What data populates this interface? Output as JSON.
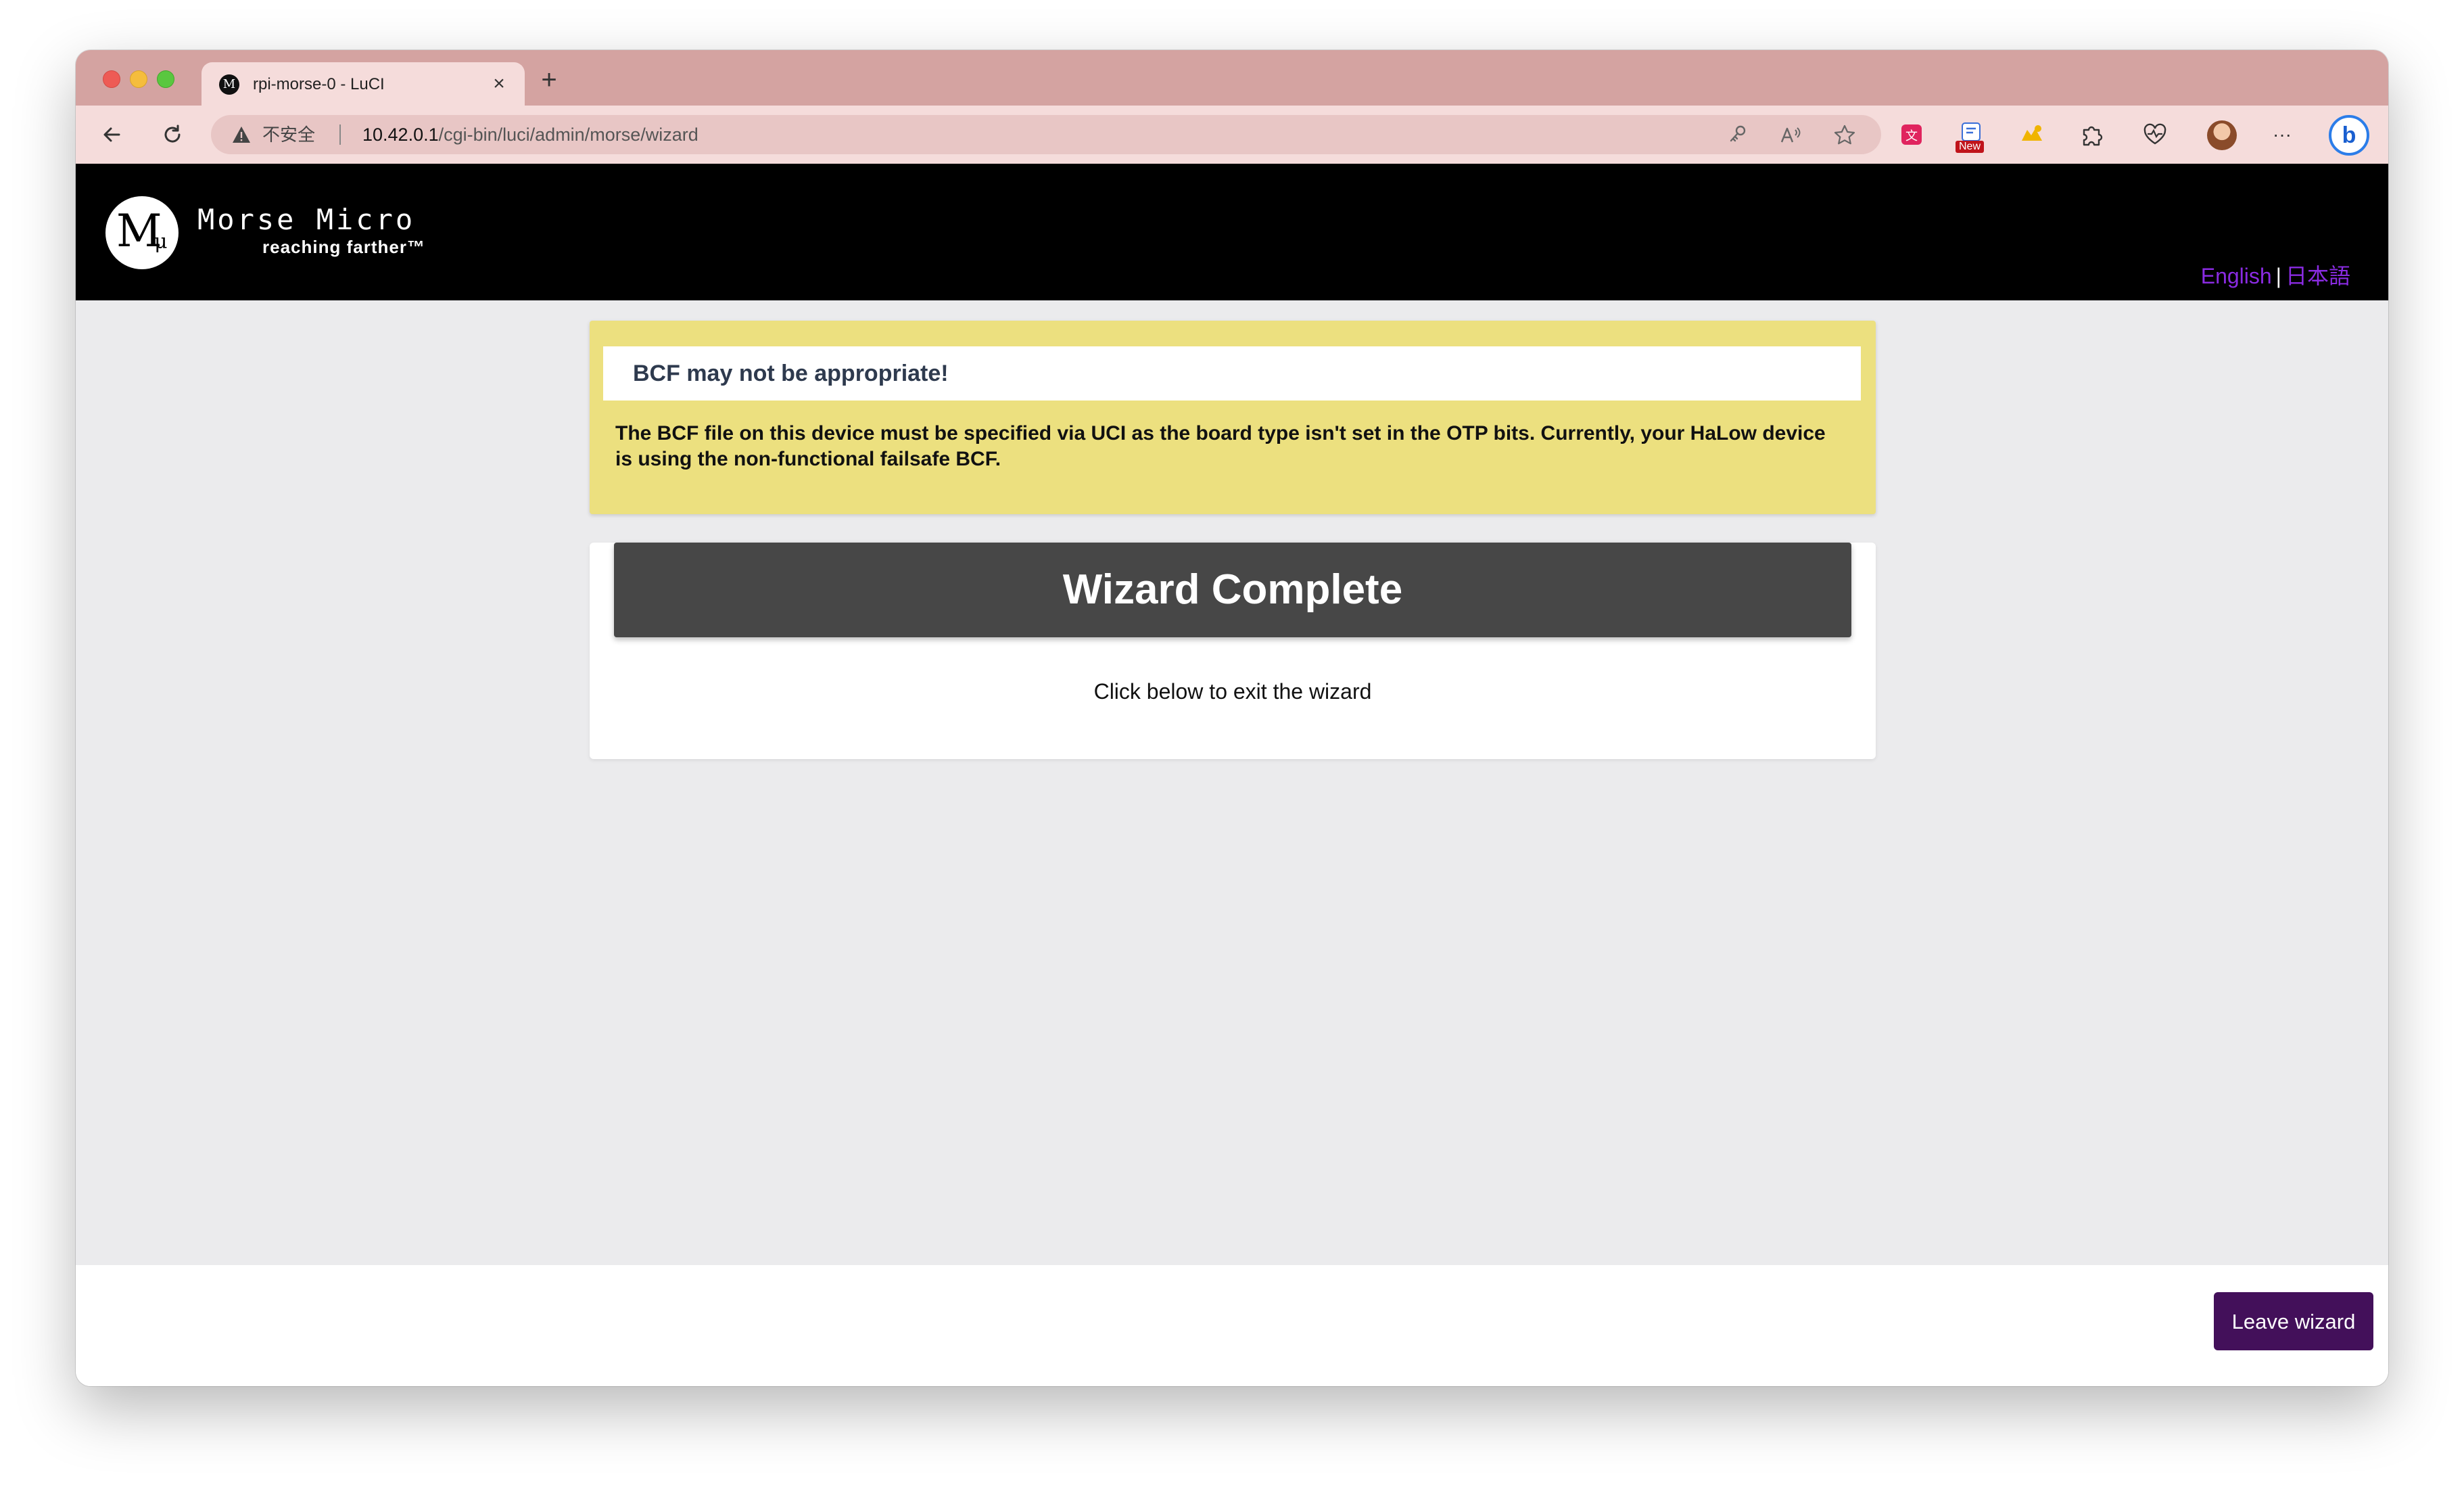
{
  "browser": {
    "tab_title": "rpi-morse-0 - LuCI",
    "tab_close": "×",
    "new_tab": "+",
    "security_label": "不安全",
    "url_host": "10.42.0.1",
    "url_path": "/cgi-bin/luci/admin/morse/wizard",
    "ext_new_badge": "New",
    "more_menu": "···"
  },
  "header": {
    "brand_name": "Morse Micro",
    "brand_tagline": "reaching farther™",
    "lang_english": "English",
    "lang_separator": "|",
    "lang_japanese": "日本語"
  },
  "warning": {
    "title": "BCF may not be appropriate!",
    "message": "The BCF file on this device must be specified via UCI as the board type isn't set in the OTP bits. Currently, your HaLow device is using the non-functional failsafe BCF."
  },
  "wizard": {
    "title": "Wizard Complete",
    "subtitle": "Click below to exit the wizard"
  },
  "footer": {
    "leave_button": "Leave wizard"
  },
  "colors": {
    "tabbar": "#d4a3a1",
    "warning_bg": "#ece07f",
    "wizard_header": "#474747",
    "leave_button": "#43105a",
    "lang_link": "#8a2be2"
  }
}
